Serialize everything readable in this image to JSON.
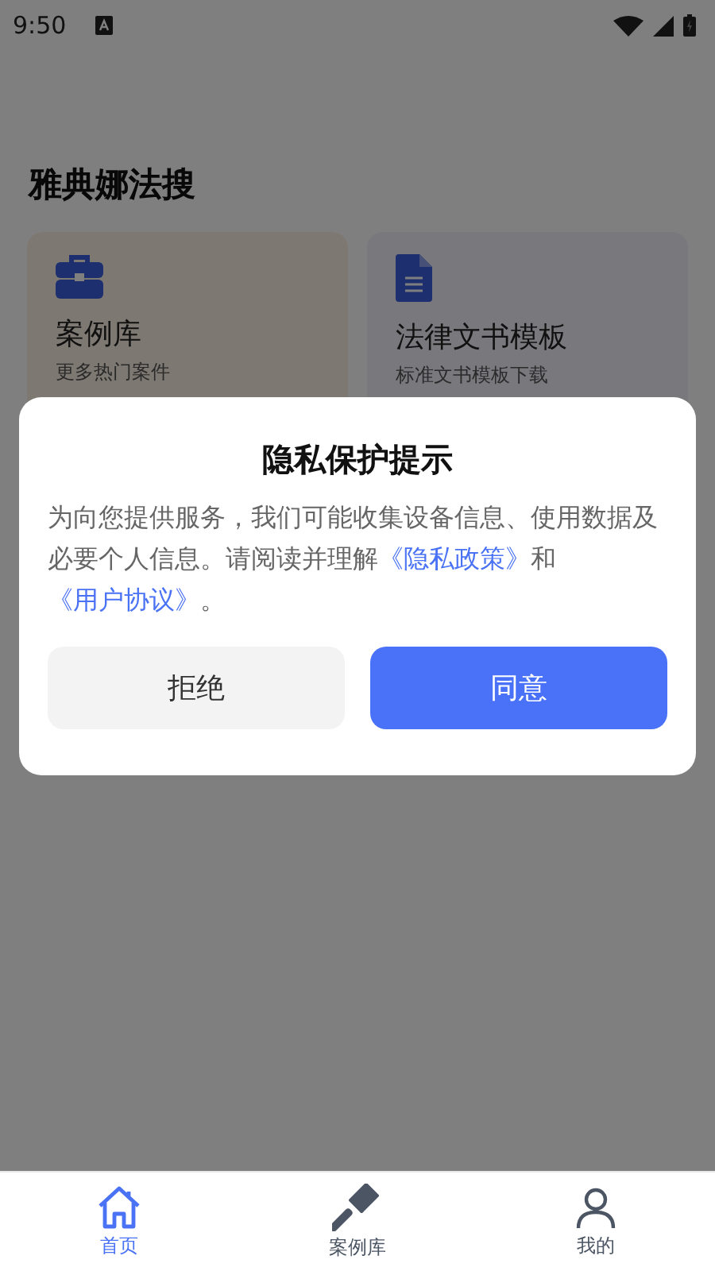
{
  "status_bar": {
    "time": "9:50"
  },
  "app_title": "雅典娜法搜",
  "cards": [
    {
      "title": "案例库",
      "subtitle": "更多热门案件",
      "kind": "briefcase"
    },
    {
      "title": "法律文书模板",
      "subtitle": "标准文书模板下载",
      "kind": "document"
    }
  ],
  "dialog": {
    "title": "隐私保护提示",
    "body": [
      {
        "kind": "text",
        "text": "为向您提供服务，我们可能收集设备信息、使用数据及必要个人信息。请阅读并理解"
      },
      {
        "kind": "link",
        "text": "《隐私政策》"
      },
      {
        "kind": "text",
        "text": "和"
      },
      {
        "kind": "link",
        "text": "《用户协议》"
      },
      {
        "kind": "text",
        "text": "。"
      }
    ],
    "buttons": [
      {
        "label": "拒绝",
        "kind": "secondary"
      },
      {
        "label": "同意",
        "kind": "primary"
      }
    ]
  },
  "bottom_nav": [
    {
      "label": "首页",
      "kind": "home",
      "selected": true
    },
    {
      "label": "案例库",
      "kind": "gavel",
      "selected": false
    },
    {
      "label": "我的",
      "kind": "person",
      "selected": false
    }
  ]
}
